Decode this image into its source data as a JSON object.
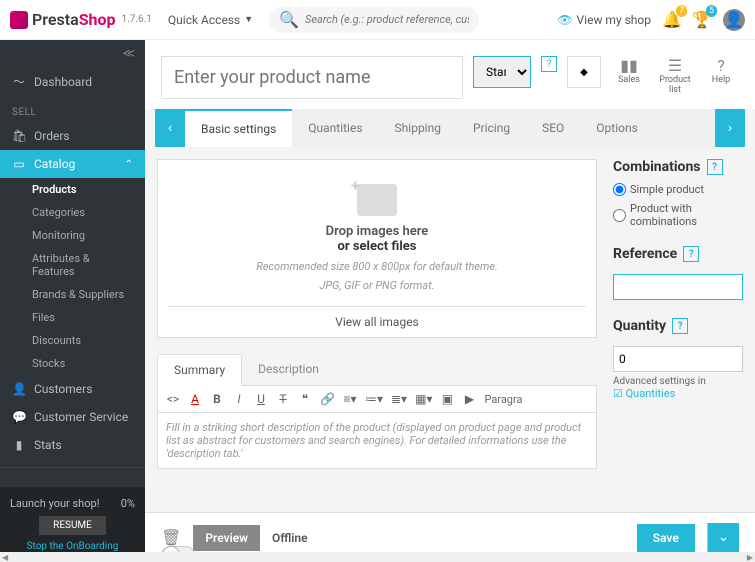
{
  "brand": {
    "presta": "Presta",
    "shop": "Shop",
    "version": "1.7.6.1"
  },
  "topbar": {
    "quick_access": "Quick Access",
    "search_placeholder": "Search (e.g.: product reference, custome",
    "view_shop": "View my shop",
    "notif_count": "7",
    "cart_count": "5"
  },
  "sidebar": {
    "dashboard": "Dashboard",
    "section_sell": "SELL",
    "orders": "Orders",
    "catalog": "Catalog",
    "catalog_sub": {
      "products": "Products",
      "categories": "Categories",
      "monitoring": "Monitoring",
      "attributes": "Attributes & Features",
      "brands": "Brands & Suppliers",
      "files": "Files",
      "discounts": "Discounts",
      "stocks": "Stocks"
    },
    "customers": "Customers",
    "customer_service": "Customer Service",
    "stats": "Stats",
    "launch": "Launch your shop!",
    "launch_pct": "0%",
    "resume": "RESUME",
    "stop": "Stop the OnBoarding"
  },
  "product": {
    "name_placeholder": "Enter your product name",
    "type_option": "Standard",
    "header_tools": {
      "sales": "Sales",
      "plist": "Product list",
      "help": "Help"
    }
  },
  "tabs": {
    "basic": "Basic settings",
    "quantities": "Quantities",
    "shipping": "Shipping",
    "pricing": "Pricing",
    "seo": "SEO",
    "options": "Options"
  },
  "dropzone": {
    "drop": "Drop images here",
    "select": "or select files",
    "hint1": "Recommended size 800 x 800px for default theme.",
    "hint2": "JPG, GIF or PNG format.",
    "view_all": "View all images"
  },
  "desc": {
    "summary": "Summary",
    "description": "Description",
    "para": "Paragra",
    "placeholder": "Fill in a striking short description of the product (displayed on product page and product list as abstract for customers and search engines). For detailed informations use the 'description tab.'"
  },
  "right": {
    "combinations": "Combinations",
    "simple": "Simple product",
    "withcomb": "Product with combinations",
    "reference": "Reference",
    "quantity": "Quantity",
    "qty_value": "0",
    "adv": "Advanced settings in",
    "adv_link": "☑ Quantities"
  },
  "footer": {
    "preview": "Preview",
    "offline": "Offline",
    "save": "Save"
  }
}
